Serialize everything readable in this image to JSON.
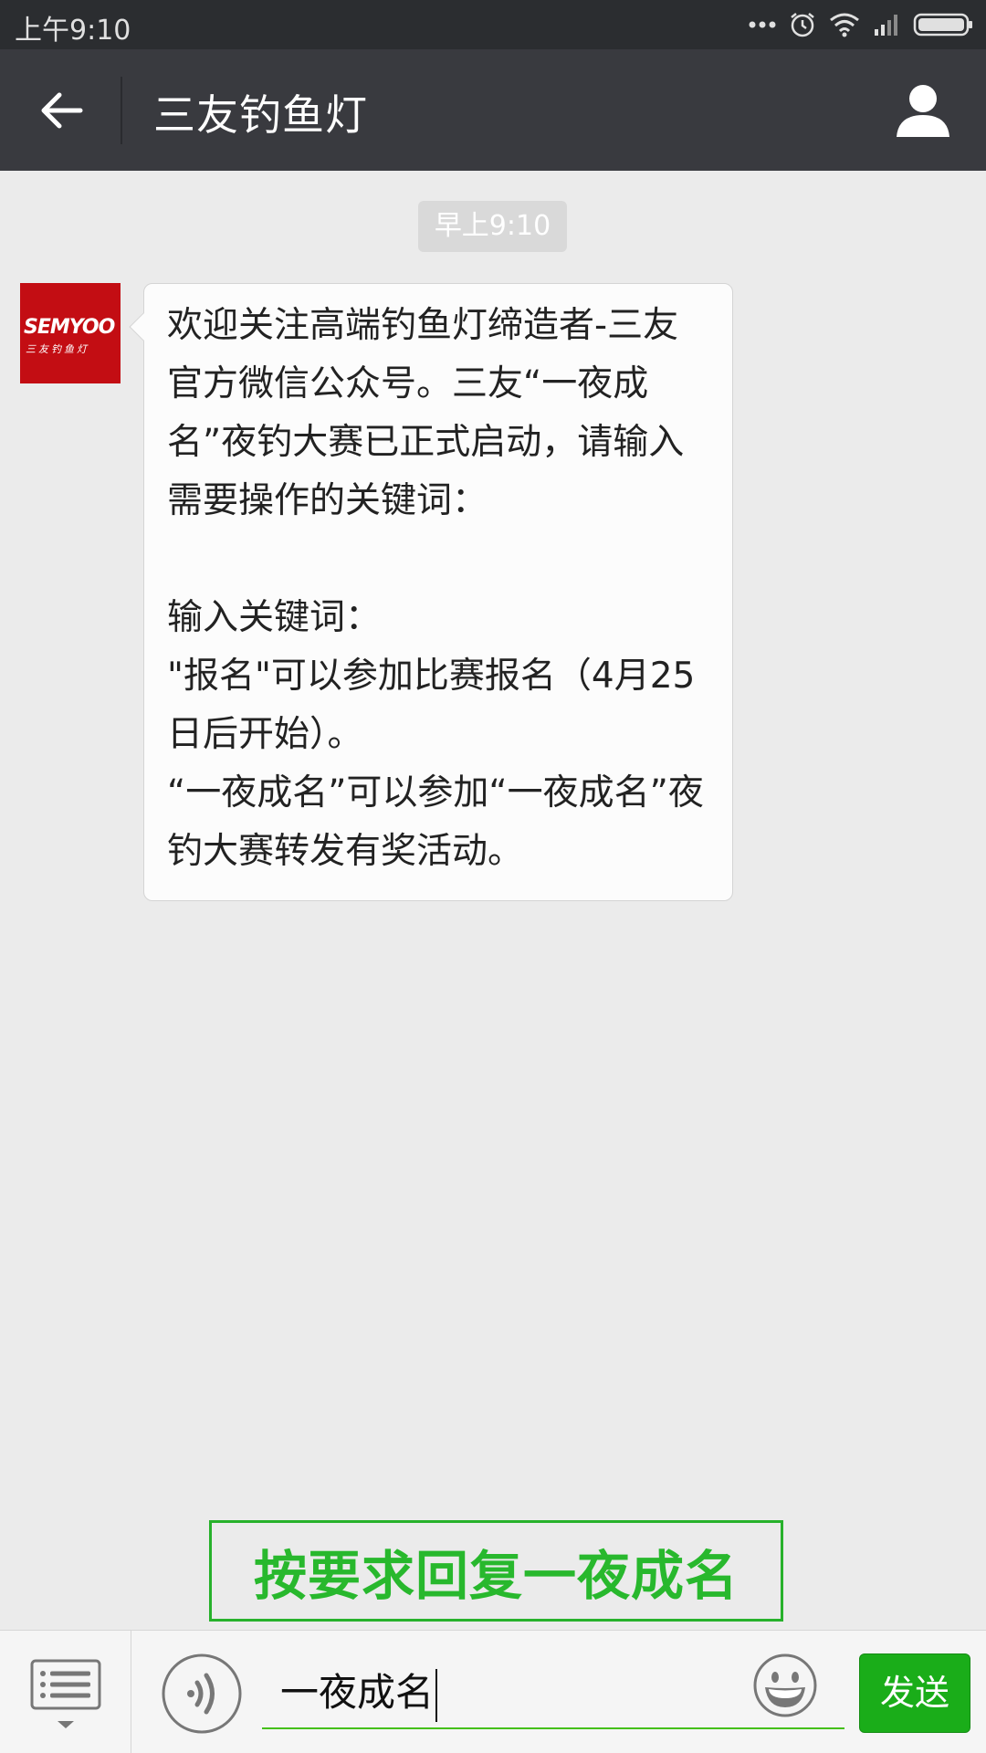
{
  "status_bar": {
    "time": "上午9:10",
    "icons": [
      "more-dots-icon",
      "alarm-icon",
      "wifi-icon",
      "signal-icon",
      "battery-icon"
    ]
  },
  "header": {
    "back_icon": "arrow-left-icon",
    "title": "三友钓鱼灯",
    "profile_icon": "person-icon"
  },
  "chat": {
    "timestamp": "早上9:10",
    "messages": [
      {
        "sender_avatar": {
          "brand_text": "SEMYOO",
          "sub_text": "三友钓鱼灯",
          "color": "#c30d13"
        },
        "text": "欢迎关注高端钓鱼灯缔造者-三友 官方微信公众号。三友“一夜成名”夜钓大赛已正式启动，请输入需要操作的关键词：\n\n输入关键词：\n\"报名\"可以参加比赛报名（4月25日后开始）。\n“一夜成名”可以参加“一夜成名”夜钓大赛转发有奖活动。"
      }
    ]
  },
  "overlay_note": {
    "text": "按要求回复一夜成名",
    "color": "#28b82d"
  },
  "input_bar": {
    "menu_icon": "list-menu-icon",
    "voice_icon": "voice-icon",
    "input_value": "一夜成名",
    "emoji_icon": "emoji-icon",
    "send_label": "发送",
    "accent": "#1aad19"
  }
}
